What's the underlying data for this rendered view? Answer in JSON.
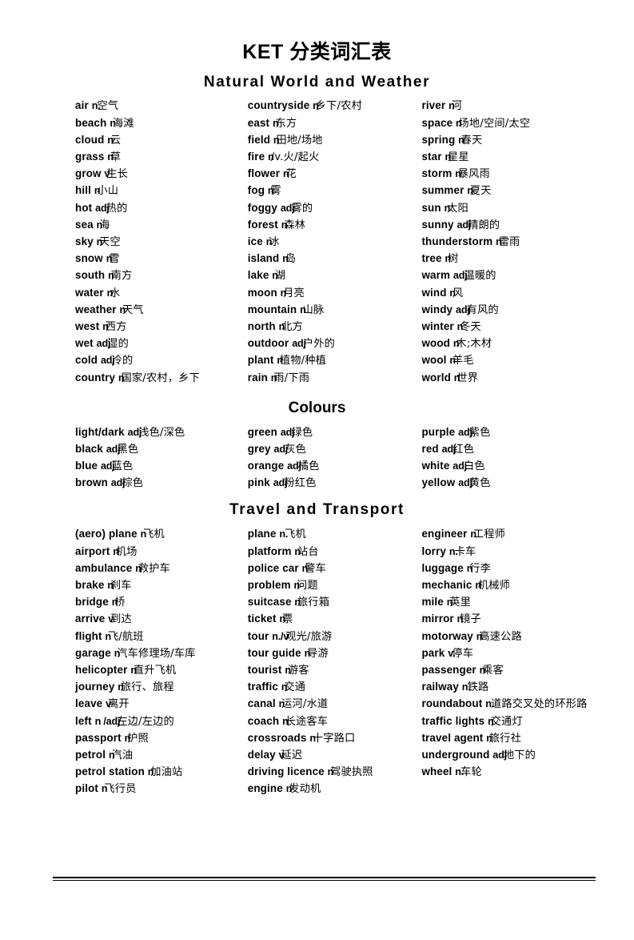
{
  "document": {
    "title": "KET 分类词汇表"
  },
  "sections": [
    {
      "heading": "Natural  World  and  Weather",
      "columns": [
        [
          {
            "term": "air",
            "pos": "n.",
            "cn": "空气"
          },
          {
            "term": "beach",
            "pos": "n",
            "cn": "海滩"
          },
          {
            "term": "cloud",
            "pos": "n",
            "cn": "云"
          },
          {
            "term": "grass",
            "pos": "n",
            "cn": "草"
          },
          {
            "term": "grow",
            "pos": "v",
            "cn": "生长"
          },
          {
            "term": "hill",
            "pos": "n",
            "cn": "小山"
          },
          {
            "term": "hot",
            "pos": "adj",
            "cn": "热的"
          },
          {
            "term": "sea",
            "pos": "n",
            "cn": "海"
          },
          {
            "term": "sky",
            "pos": "n",
            "cn": "天空"
          },
          {
            "term": "snow",
            "pos": "n",
            "cn": "雪"
          },
          {
            "term": "south",
            "pos": "n",
            "cn": "南方"
          },
          {
            "term": "water",
            "pos": "n",
            "cn": "水"
          },
          {
            "term": "weather",
            "pos": "n",
            "cn": "天气"
          },
          {
            "term": "west",
            "pos": "n",
            "cn": "西方"
          },
          {
            "term": "wet",
            "pos": "adj",
            "cn": "湿的"
          },
          {
            "term": "cold",
            "pos": "adj",
            "cn": "冷的"
          },
          {
            "term": "country",
            "pos": "n",
            "cn": "国家/农村，乡下"
          }
        ],
        [
          {
            "term": "countryside",
            "pos": "n",
            "cn": "乡下/农村"
          },
          {
            "term": "east",
            "pos": "n",
            "cn": "东方"
          },
          {
            "term": "field",
            "pos": "n",
            "cn": "田地/场地"
          },
          {
            "term": "fire",
            "pos": "n",
            "cn": "/v.火/起火"
          },
          {
            "term": "flower",
            "pos": "n",
            "cn": "花"
          },
          {
            "term": "fog",
            "pos": "n",
            "cn": "雾"
          },
          {
            "term": "foggy",
            "pos": "adj",
            "cn": "雾的"
          },
          {
            "term": "forest",
            "pos": "n",
            "cn": "森林"
          },
          {
            "term": "ice",
            "pos": "n",
            "cn": "冰"
          },
          {
            "term": "island",
            "pos": "n",
            "cn": "岛"
          },
          {
            "term": "lake",
            "pos": "n",
            "cn": "湖"
          },
          {
            "term": "moon",
            "pos": "n",
            "cn": "月亮"
          },
          {
            "term": "mountain",
            "pos": "n",
            "cn": "山脉"
          },
          {
            "term": "north",
            "pos": "n",
            "cn": "北方"
          },
          {
            "term": "outdoor",
            "pos": "adj",
            "cn": "户外的"
          },
          {
            "term": "plant",
            "pos": "n",
            "cn": "植物/种植"
          },
          {
            "term": "rain",
            "pos": "n",
            "cn": "雨/下雨"
          }
        ],
        [
          {
            "term": "river",
            "pos": "n",
            "cn": "河"
          },
          {
            "term": "space",
            "pos": "n",
            "cn": "场地/空间/太空"
          },
          {
            "term": "spring",
            "pos": "n",
            "cn": "春天"
          },
          {
            "term": "star",
            "pos": "n",
            "cn": "星星"
          },
          {
            "term": "storm",
            "pos": "n",
            "cn": "暴风雨"
          },
          {
            "term": "summer",
            "pos": "n",
            "cn": "夏天"
          },
          {
            "term": "sun",
            "pos": "n",
            "cn": "太阳"
          },
          {
            "term": "sunny",
            "pos": "adj",
            "cn": "晴朗的"
          },
          {
            "term": "thunderstorm",
            "pos": "n",
            "cn": "雷雨"
          },
          {
            "term": "tree",
            "pos": "n",
            "cn": "树"
          },
          {
            "term": "warm",
            "pos": "adj",
            "cn": "温暖的"
          },
          {
            "term": "wind",
            "pos": "n",
            "cn": "风"
          },
          {
            "term": "windy",
            "pos": "adj",
            "cn": "有风的"
          },
          {
            "term": "winter",
            "pos": "n",
            "cn": "冬天"
          },
          {
            "term": "wood",
            "pos": "n",
            "cn": "木;木材"
          },
          {
            "term": "wool",
            "pos": "n",
            "cn": "羊毛"
          },
          {
            "term": "world",
            "pos": "n",
            "cn": "世界"
          }
        ]
      ]
    },
    {
      "heading": "Colours",
      "columns": [
        [
          {
            "term": "light/dark",
            "pos": "adj",
            "cn": "浅色/深色"
          },
          {
            "term": "black",
            "pos": "adj",
            "cn": "黑色"
          },
          {
            "term": "blue",
            "pos": "adj",
            "cn": "蓝色"
          },
          {
            "term": "brown",
            "pos": "adj",
            "cn": "棕色"
          }
        ],
        [
          {
            "term": "green",
            "pos": "adj",
            "cn": "绿色"
          },
          {
            "term": "grey",
            "pos": "adj",
            "cn": "灰色"
          },
          {
            "term": "orange",
            "pos": "adj",
            "cn": "橘色"
          },
          {
            "term": "pink",
            "pos": "adj",
            "cn": "粉红色"
          }
        ],
        [
          {
            "term": "purple",
            "pos": "adj",
            "cn": "紫色"
          },
          {
            "term": "red",
            "pos": "adj",
            "cn": "红色"
          },
          {
            "term": "white",
            "pos": "adj",
            "cn": "白色"
          },
          {
            "term": "yellow",
            "pos": "adj",
            "cn": "黄色"
          }
        ]
      ]
    },
    {
      "heading": "Travel  and  Transport",
      "columns": [
        [
          {
            "term": "(aero) plane",
            "pos": "n",
            "cn": "飞机"
          },
          {
            "term": "airport",
            "pos": "n",
            "cn": "机场"
          },
          {
            "term": "ambulance",
            "pos": "n",
            "cn": "救护车"
          },
          {
            "term": "brake",
            "pos": "n",
            "cn": "刹车"
          },
          {
            "term": "bridge",
            "pos": "n",
            "cn": "桥"
          },
          {
            "term": "arrive",
            "pos": "v",
            "cn": "到达"
          },
          {
            "term": "flight",
            "pos": "n",
            "cn": "飞/航班"
          },
          {
            "term": "garage",
            "pos": "n",
            "cn": "汽车修理场/车库"
          },
          {
            "term": "helicopter",
            "pos": "n",
            "cn": "直升飞机"
          },
          {
            "term": "journey",
            "pos": "n",
            "cn": "旅行、旅程"
          },
          {
            "term": "leave",
            "pos": "v",
            "cn": "离开"
          },
          {
            "term": "left",
            "pos": "n /adj",
            "cn": "左边/左边的"
          },
          {
            "term": "passport",
            "pos": "n",
            "cn": "护照"
          },
          {
            "term": "petrol",
            "pos": "n",
            "cn": "汽油"
          },
          {
            "term": "petrol station",
            "pos": "n",
            "cn": "加油站"
          },
          {
            "term": "pilot",
            "pos": "n",
            "cn": "飞行员"
          }
        ],
        [
          {
            "term": "plane",
            "pos": "n.",
            "cn": "飞机"
          },
          {
            "term": "platform",
            "pos": "n",
            "cn": "站台"
          },
          {
            "term": "police car",
            "pos": "n",
            "cn": "警车"
          },
          {
            "term": "problem",
            "pos": "n",
            "cn": "问题"
          },
          {
            "term": "suitcase",
            "pos": "n",
            "cn": "旅行箱"
          },
          {
            "term": "ticket",
            "pos": "n",
            "cn": "票"
          },
          {
            "term": "tour",
            "pos": "n./v",
            "cn": "观光/旅游"
          },
          {
            "term": "tour guide",
            "pos": "n",
            "cn": "导游"
          },
          {
            "term": "tourist",
            "pos": "n",
            "cn": "游客"
          },
          {
            "term": "traffic",
            "pos": "n",
            "cn": "交通"
          },
          {
            "term": "canal",
            "pos": "n",
            "cn": "运河/水道"
          },
          {
            "term": "coach",
            "pos": "n",
            "cn": "长途客车"
          },
          {
            "term": "crossroads",
            "pos": "n",
            "cn": "十字路口"
          },
          {
            "term": "delay",
            "pos": "v",
            "cn": "延迟"
          },
          {
            "term": "driving licence",
            "pos": "n",
            "cn": "驾驶执照"
          },
          {
            "term": "engine",
            "pos": "n",
            "cn": "发动机"
          }
        ],
        [
          {
            "term": "engineer",
            "pos": "n",
            "cn": "工程师"
          },
          {
            "term": "lorry",
            "pos": "n.",
            "cn": "卡车"
          },
          {
            "term": "luggage",
            "pos": "n",
            "cn": "行李"
          },
          {
            "term": "mechanic",
            "pos": "n",
            "cn": "机械师"
          },
          {
            "term": "mile",
            "pos": "n",
            "cn": "英里"
          },
          {
            "term": "mirror",
            "pos": "n",
            "cn": "镜子"
          },
          {
            "term": "motorway",
            "pos": "n",
            "cn": "高速公路"
          },
          {
            "term": "park",
            "pos": "v.",
            "cn": "停车"
          },
          {
            "term": "passenger",
            "pos": "n",
            "cn": "乘客"
          },
          {
            "term": "railway",
            "pos": "n.",
            "cn": "铁路"
          },
          {
            "term": "roundabout",
            "pos": "n.",
            "cn": "道路交叉处的环形路",
            "wrap": true
          },
          {
            "term": "traffic lights",
            "pos": "n",
            "cn": "交通灯"
          },
          {
            "term": "travel agent",
            "pos": "n",
            "cn": "旅行社"
          },
          {
            "term": "underground",
            "pos": "adj",
            "cn": "地下的"
          },
          {
            "term": "wheel",
            "pos": "n.",
            "cn": "车轮"
          }
        ]
      ]
    }
  ]
}
